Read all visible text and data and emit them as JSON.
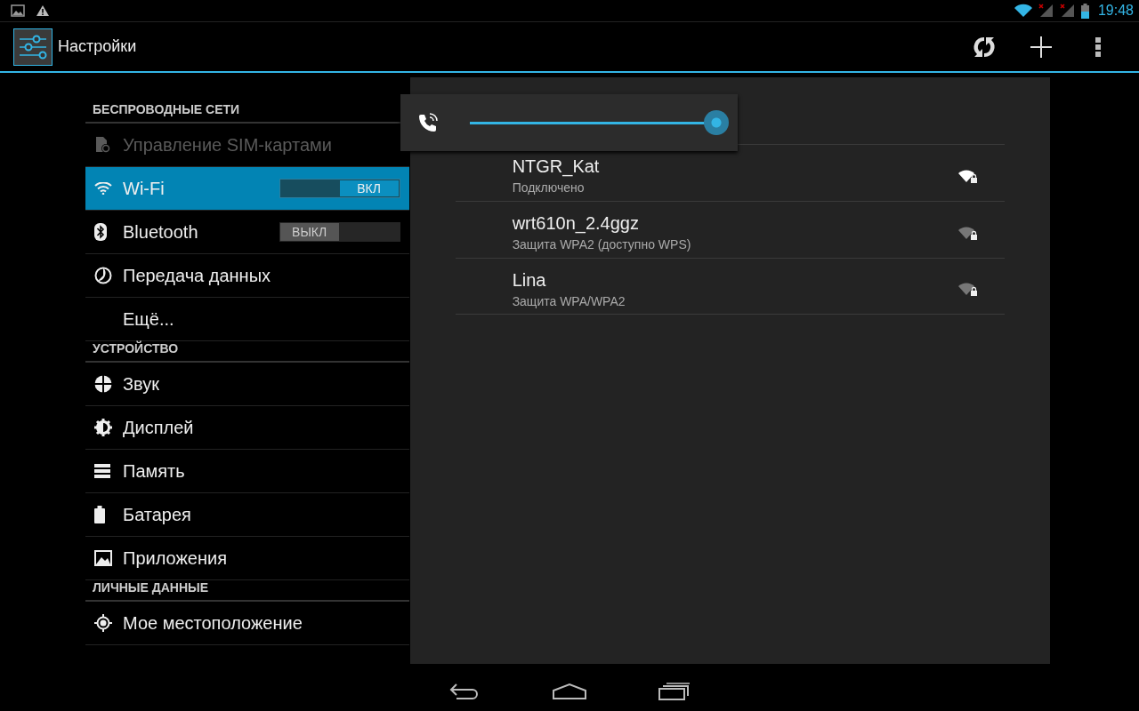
{
  "status_bar": {
    "time": "19:48"
  },
  "action_bar": {
    "title": "Настройки"
  },
  "sidebar": {
    "sections": [
      {
        "header": "БЕСПРОВОДНЫЕ СЕТИ",
        "items": [
          {
            "label": "Управление SIM-картами",
            "kind": "plain",
            "selected": false,
            "disabled": true
          },
          {
            "label": "Wi-Fi",
            "kind": "toggle",
            "selected": true,
            "disabled": false,
            "on": true,
            "toggle_label": "ВКЛ"
          },
          {
            "label": "Bluetooth",
            "kind": "toggle",
            "selected": false,
            "disabled": false,
            "on": false,
            "toggle_label": "ВЫКЛ"
          },
          {
            "label": "Передача данных",
            "kind": "plain",
            "selected": false,
            "disabled": false
          },
          {
            "label": "Ещё...",
            "kind": "plain",
            "selected": false,
            "disabled": false
          }
        ]
      },
      {
        "header": "УСТРОЙСТВО",
        "items": [
          {
            "label": "Звук",
            "kind": "plain",
            "selected": false,
            "disabled": false
          },
          {
            "label": "Дисплей",
            "kind": "plain",
            "selected": false,
            "disabled": false
          },
          {
            "label": "Память",
            "kind": "plain",
            "selected": false,
            "disabled": false
          },
          {
            "label": "Батарея",
            "kind": "plain",
            "selected": false,
            "disabled": false
          },
          {
            "label": "Приложения",
            "kind": "plain",
            "selected": false,
            "disabled": false
          }
        ]
      },
      {
        "header": "ЛИЧНЫЕ ДАННЫЕ",
        "items": [
          {
            "label": "Мое местоположение",
            "kind": "plain",
            "selected": false,
            "disabled": false
          }
        ]
      }
    ]
  },
  "networks": [
    {
      "name": "NTGR_Kat",
      "status": "Подключено",
      "connected": true
    },
    {
      "name": "wrt610n_2.4ggz",
      "status": "Защита WPA2 (доступно WPS)",
      "connected": false
    },
    {
      "name": "Lina",
      "status": "Защита WPA/WPA2",
      "connected": false
    }
  ],
  "volume_popup": {
    "level": 0.98
  }
}
